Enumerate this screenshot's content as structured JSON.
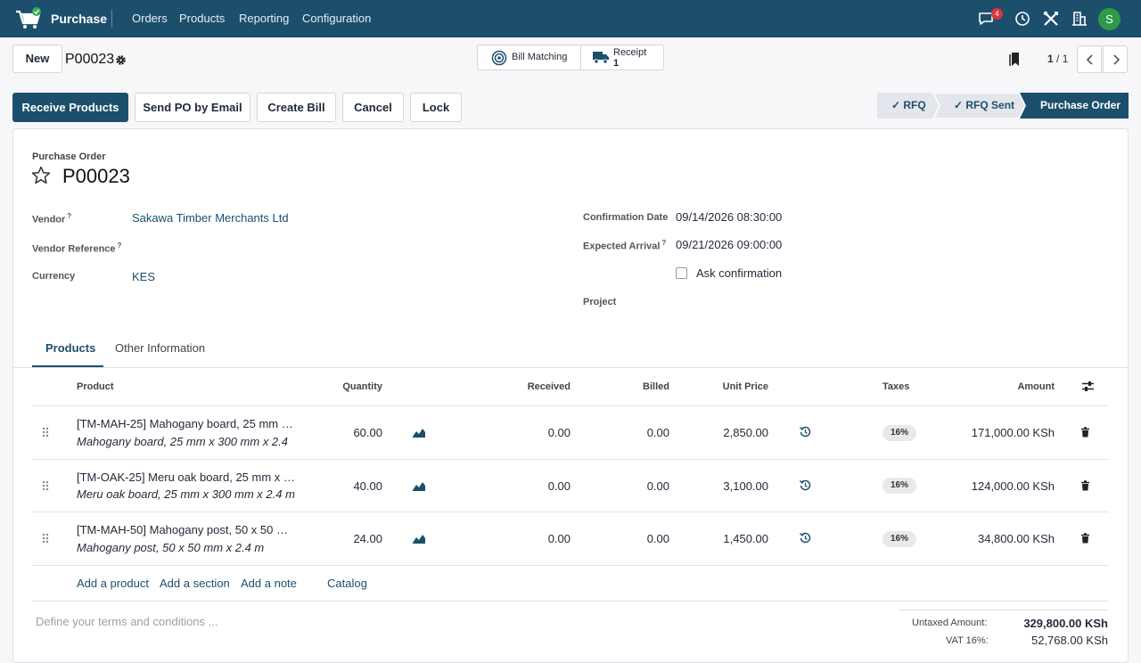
{
  "topbar": {
    "app_name": "Purchase",
    "menu": [
      "Orders",
      "Products",
      "Reporting",
      "Configuration"
    ],
    "messages_badge": "4",
    "avatar_letter": "S"
  },
  "control": {
    "new_label": "New",
    "breadcrumb": "P00023",
    "bill_matching_label": "Bill Matching",
    "receipt_label": "Receipt",
    "receipt_count": "1",
    "pager_current": "1",
    "pager_sep": "/",
    "pager_total": "1"
  },
  "actions": {
    "receive": "Receive Products",
    "send_email": "Send PO by Email",
    "create_bill": "Create Bill",
    "cancel": "Cancel",
    "lock": "Lock"
  },
  "statusbar": {
    "rfq": "✓  RFQ",
    "rfq_sent": "✓  RFQ Sent",
    "purchase_order": "Purchase Order"
  },
  "form": {
    "doc_type": "Purchase Order",
    "doc_name": "P00023",
    "vendor_label": "Vendor",
    "vendor_value": "Sakawa Timber Merchants Ltd",
    "vendor_ref_label": "Vendor Reference",
    "currency_label": "Currency",
    "currency_value": "KES",
    "confirmation_label": "Confirmation Date",
    "confirmation_value": "09/14/2026 08:30:00",
    "expected_label": "Expected Arrival",
    "expected_value": "09/21/2026 09:00:00",
    "ask_confirmation_label": "Ask confirmation",
    "project_label": "Project",
    "help_mark": "?"
  },
  "tabs": {
    "products": "Products",
    "other": "Other Information"
  },
  "table": {
    "headers": {
      "product": "Product",
      "quantity": "Quantity",
      "received": "Received",
      "billed": "Billed",
      "unit_price": "Unit Price",
      "taxes": "Taxes",
      "amount": "Amount"
    },
    "rows": [
      {
        "product": "[TM-MAH-25] Mahogany board, 25 mm …",
        "description": "Mahogany board, 25 mm x 300 mm x 2.4",
        "quantity": "60.00",
        "received": "0.00",
        "billed": "0.00",
        "unit_price": "2,850.00",
        "tax": "16%",
        "amount": "171,000.00 KSh"
      },
      {
        "product": "[TM-OAK-25] Meru oak board, 25 mm x …",
        "description": "Meru oak board, 25 mm x 300 mm x 2.4 m",
        "quantity": "40.00",
        "received": "0.00",
        "billed": "0.00",
        "unit_price": "3,100.00",
        "tax": "16%",
        "amount": "124,000.00 KSh"
      },
      {
        "product": "[TM-MAH-50] Mahogany post, 50 x 50 …",
        "description": "Mahogany post, 50 x 50 mm x 2.4 m",
        "quantity": "24.00",
        "received": "0.00",
        "billed": "0.00",
        "unit_price": "1,450.00",
        "tax": "16%",
        "amount": "34,800.00 KSh"
      }
    ],
    "add_product": "Add a product",
    "add_section": "Add a section",
    "add_note": "Add a note",
    "catalog": "Catalog"
  },
  "footer": {
    "terms_placeholder": "Define your terms and conditions ...",
    "untaxed_label": "Untaxed Amount:",
    "untaxed_value": "329,800.00 KSh",
    "vat_label": "VAT 16%:",
    "vat_value": "52,768.00 KSh"
  },
  "colors": {
    "brand": "#1c4f6c",
    "badge": "#d9363e",
    "avatar": "#2e9a48"
  }
}
